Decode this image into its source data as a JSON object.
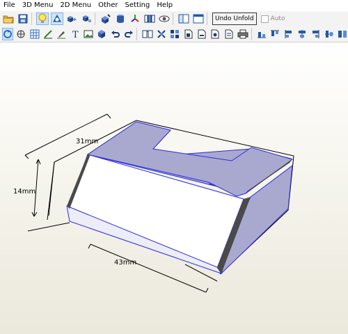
{
  "menu": [
    "File",
    "3D Menu",
    "2D Menu",
    "Other",
    "Setting",
    "Help"
  ],
  "toolbar1_icons": [
    "open-folder",
    "save",
    "bulb",
    "3d-view",
    "cubes-a",
    "cubes-b",
    "box-paint",
    "cylinder",
    "axes",
    "unfold-panels",
    "eye",
    "panel-left",
    "panel-window"
  ],
  "toolbar2_icons": [
    "rotate",
    "pan",
    "grid-snap",
    "pen-line",
    "brush",
    "text",
    "image",
    "cube-select",
    "undo-arrow",
    "redo-arrow",
    "book-open",
    "cross-pattern",
    "layers-grid",
    "page-a",
    "page-b",
    "page-c",
    "page-d",
    "printer",
    "align-1",
    "align-2",
    "align-3",
    "align-4",
    "align-5",
    "align-6",
    "align-7"
  ],
  "undo_unfold_label": "Undo Unfold",
  "auto_label": "Auto",
  "dimensions": {
    "width": "31mm",
    "height": "14mm",
    "length": "43mm"
  },
  "colors": {
    "top_face": "#a9a9cf",
    "front_face": "#ffffff",
    "edge": "#2a2ae0",
    "dark_side": "#4a4a4a"
  }
}
